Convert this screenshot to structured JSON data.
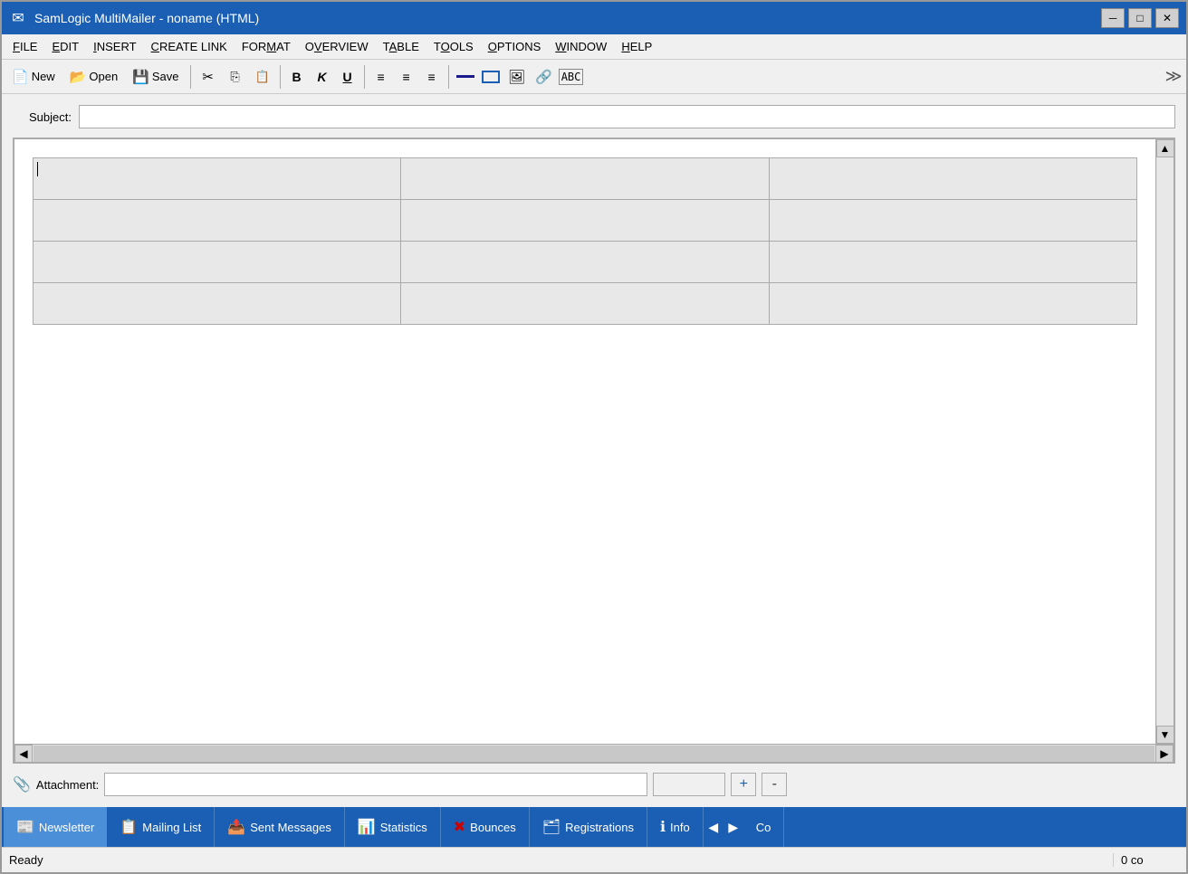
{
  "window": {
    "title": "SamLogic MultiMailer - noname  (HTML)",
    "icon": "✉"
  },
  "titlebar_controls": {
    "minimize": "─",
    "maximize": "□",
    "close": "✕"
  },
  "menu": {
    "items": [
      {
        "label": "FILE",
        "underline_index": 0
      },
      {
        "label": "EDIT",
        "underline_index": 0
      },
      {
        "label": "INSERT",
        "underline_index": 0
      },
      {
        "label": "CREATE LINK",
        "underline_index": 0
      },
      {
        "label": "FORMAT",
        "underline_index": 0
      },
      {
        "label": "OVERVIEW",
        "underline_index": 0
      },
      {
        "label": "TABLE",
        "underline_index": 0
      },
      {
        "label": "TOOLS",
        "underline_index": 0
      },
      {
        "label": "OPTIONS",
        "underline_index": 0
      },
      {
        "label": "WINDOW",
        "underline_index": 0
      },
      {
        "label": "HELP",
        "underline_index": 0
      }
    ]
  },
  "toolbar": {
    "new_label": "New",
    "open_label": "Open",
    "save_label": "Save"
  },
  "subject": {
    "label": "Subject:",
    "value": "",
    "placeholder": ""
  },
  "attachment": {
    "label": "Attachment:",
    "value": "",
    "add_label": "+",
    "remove_label": "-"
  },
  "tabs": [
    {
      "id": "newsletter",
      "label": "Newsletter",
      "icon": "📰",
      "active": true
    },
    {
      "id": "mailing-list",
      "label": "Mailing List",
      "icon": "📋",
      "active": false
    },
    {
      "id": "sent-messages",
      "label": "Sent Messages",
      "icon": "📤",
      "active": false
    },
    {
      "id": "statistics",
      "label": "Statistics",
      "icon": "📊",
      "active": false
    },
    {
      "id": "bounces",
      "label": "Bounces",
      "icon": "❌",
      "active": false
    },
    {
      "id": "registrations",
      "label": "Registrations",
      "icon": "🗂",
      "active": false
    },
    {
      "id": "info",
      "label": "Info",
      "icon": "ℹ",
      "active": false
    },
    {
      "id": "co",
      "label": "Co",
      "icon": "",
      "active": false
    }
  ],
  "status": {
    "left": "Ready",
    "right": "0 co"
  }
}
